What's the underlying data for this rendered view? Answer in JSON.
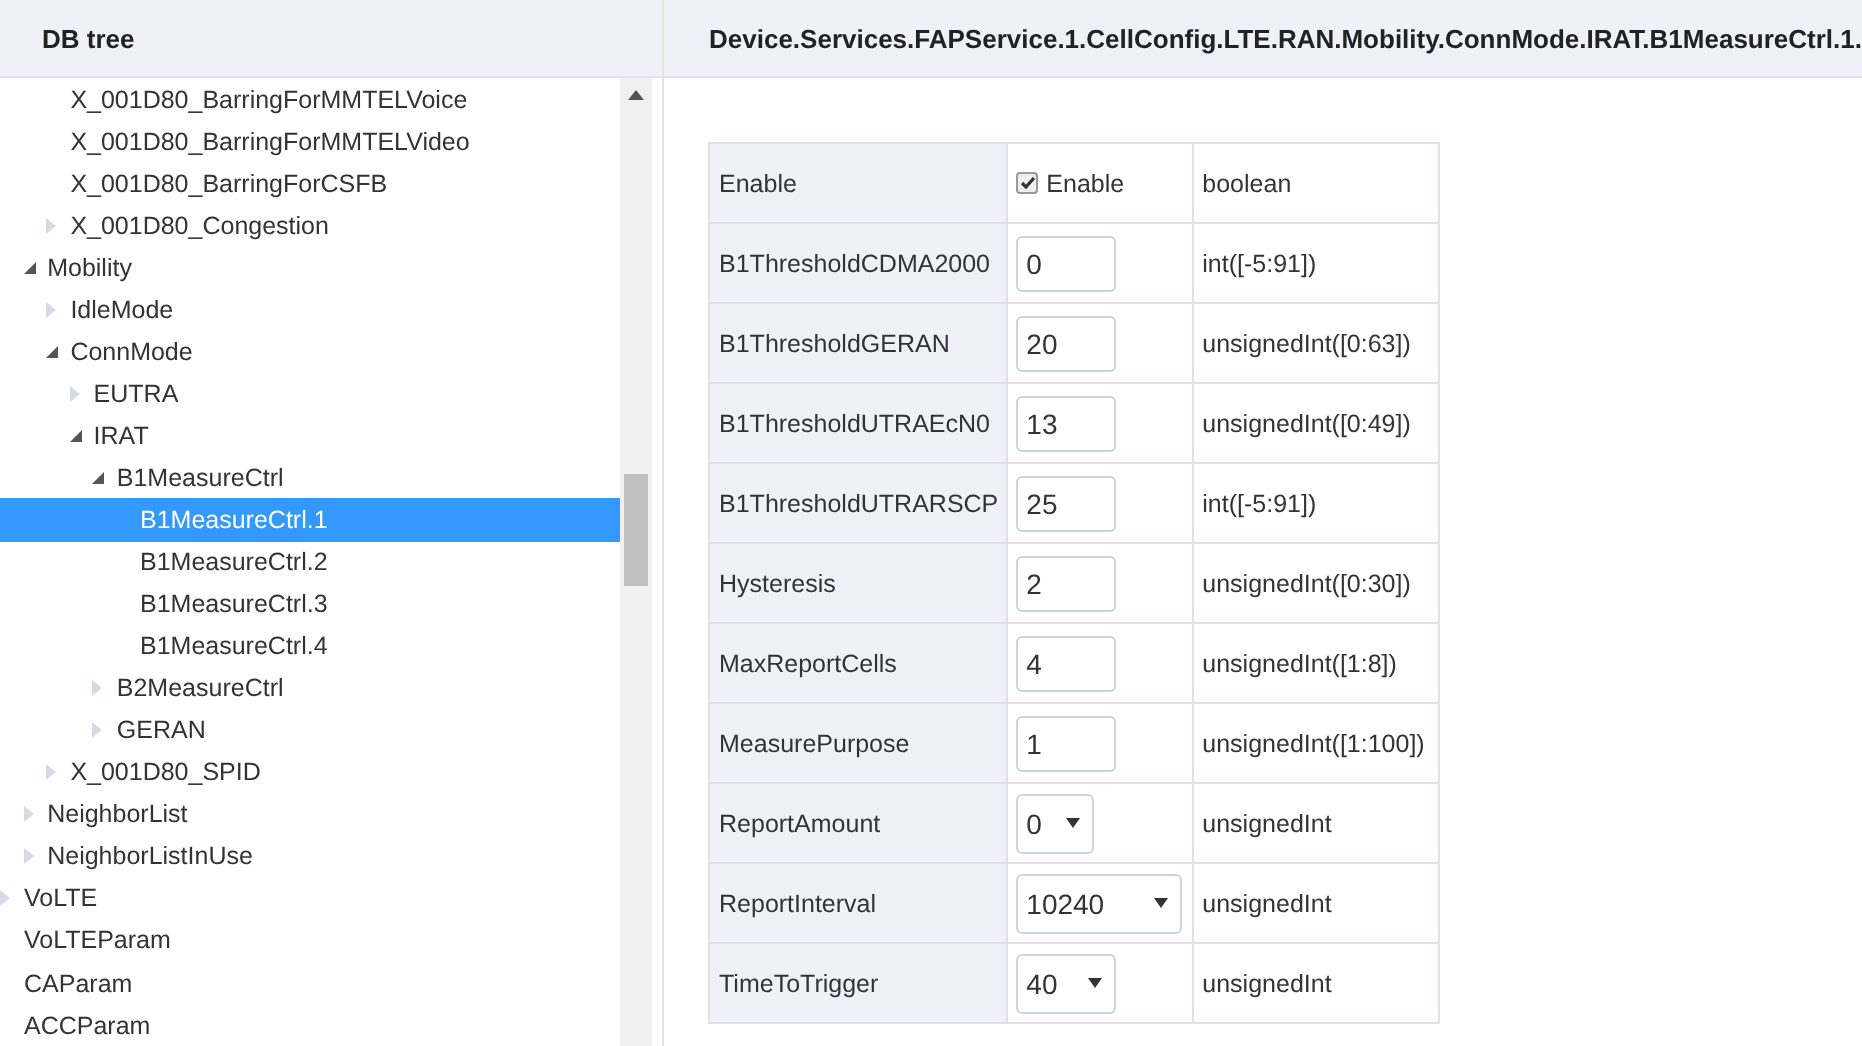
{
  "tree": {
    "title": "DB tree",
    "items": [
      {
        "children": [
          {
            "children": [
              {
                "label": "X_001D80_BarringForMMTELVoice",
                "selected": false
              },
              {
                "label": "X_001D80_BarringForMMTELVideo",
                "selected": false
              },
              {
                "label": "X_001D80_BarringForCSFB",
                "selected": false
              },
              {
                "label": "X_001D80_Congestion",
                "expanded": false,
                "selected": false
              }
            ]
          },
          {
            "label": "Mobility",
            "expanded": true,
            "selected": false,
            "children": [
              {
                "label": "IdleMode",
                "expanded": false,
                "selected": false
              },
              {
                "label": "ConnMode",
                "expanded": true,
                "selected": false,
                "children": [
                  {
                    "label": "EUTRA",
                    "expanded": false,
                    "selected": false
                  },
                  {
                    "label": "IRAT",
                    "expanded": true,
                    "selected": false,
                    "children": [
                      {
                        "label": "B1MeasureCtrl",
                        "expanded": true,
                        "selected": false,
                        "children": [
                          {
                            "label": "B1MeasureCtrl.1",
                            "selected": true
                          },
                          {
                            "label": "B1MeasureCtrl.2",
                            "selected": false
                          },
                          {
                            "label": "B1MeasureCtrl.3",
                            "selected": false
                          },
                          {
                            "label": "B1MeasureCtrl.4",
                            "selected": false
                          }
                        ]
                      },
                      {
                        "label": "B2MeasureCtrl",
                        "expanded": false,
                        "selected": false
                      },
                      {
                        "label": "GERAN",
                        "expanded": false,
                        "selected": false
                      }
                    ]
                  }
                ]
              },
              {
                "label": "X_001D80_SPID",
                "expanded": false,
                "selected": false
              }
            ]
          },
          {
            "label": "NeighborList",
            "expanded": false,
            "selected": false
          },
          {
            "label": "NeighborListInUse",
            "expanded": false,
            "selected": false
          }
        ]
      },
      {
        "label": "VoLTE",
        "expanded": false,
        "selected": false
      },
      {
        "label": "VoLTEParam",
        "selected": false
      },
      {
        "label": "CAParam",
        "selected": false
      },
      {
        "label": "ACCParam",
        "selected": false
      }
    ]
  },
  "path_title": "Device.Services.FAPService.1.CellConfig.LTE.RAN.Mobility.ConnMode.IRAT.B1MeasureCtrl.1.",
  "parameters": [
    {
      "name": "Enable",
      "kind": "checkbox",
      "checked": true,
      "value": "Enable",
      "type": "boolean"
    },
    {
      "name": "B1ThresholdCDMA2000",
      "kind": "input",
      "value": "0",
      "type": "int([-5:91])"
    },
    {
      "name": "B1ThresholdGERAN",
      "kind": "input",
      "value": "20",
      "type": "unsignedInt([0:63])"
    },
    {
      "name": "B1ThresholdUTRAEcN0",
      "kind": "input",
      "value": "13",
      "type": "unsignedInt([0:49])"
    },
    {
      "name": "B1ThresholdUTRARSCP",
      "kind": "input",
      "value": "25",
      "type": "int([-5:91])"
    },
    {
      "name": "Hysteresis",
      "kind": "input",
      "value": "2",
      "type": "unsignedInt([0:30])"
    },
    {
      "name": "MaxReportCells",
      "kind": "input",
      "value": "4",
      "type": "unsignedInt([1:8])"
    },
    {
      "name": "MeasurePurpose",
      "kind": "input",
      "value": "1",
      "type": "unsignedInt([1:100])"
    },
    {
      "name": "ReportAmount",
      "kind": "select",
      "value": "0",
      "type": "unsignedInt"
    },
    {
      "name": "ReportInterval",
      "kind": "select",
      "value": "10240",
      "type": "unsignedInt"
    },
    {
      "name": "TimeToTrigger",
      "kind": "select",
      "value": "40",
      "type": "unsignedInt"
    }
  ]
}
